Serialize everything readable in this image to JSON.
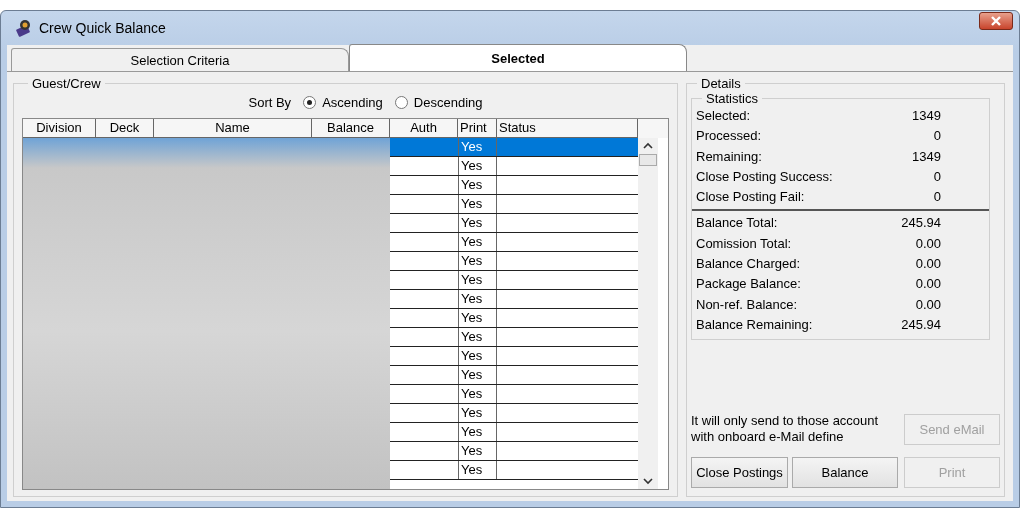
{
  "window": {
    "title": "Crew Quick Balance"
  },
  "tabs": [
    {
      "label": "Selection Criteria",
      "selected": false
    },
    {
      "label": "Selected",
      "selected": true
    }
  ],
  "guest_crew": {
    "title": "Guest/Crew",
    "sort_by": {
      "label": "Sort By",
      "options": [
        {
          "label": "Ascending",
          "selected": true
        },
        {
          "label": "Descending",
          "selected": false
        }
      ]
    },
    "table": {
      "columns": [
        "Division",
        "Deck",
        "Name",
        "Balance",
        "Auth",
        "Print",
        "Status"
      ],
      "rows": [
        {
          "selected": true,
          "print": "Yes"
        },
        {
          "selected": false,
          "print": "Yes"
        },
        {
          "selected": false,
          "print": "Yes"
        },
        {
          "selected": false,
          "print": "Yes"
        },
        {
          "selected": false,
          "print": "Yes"
        },
        {
          "selected": false,
          "print": "Yes"
        },
        {
          "selected": false,
          "print": "Yes"
        },
        {
          "selected": false,
          "print": "Yes"
        },
        {
          "selected": false,
          "print": "Yes"
        },
        {
          "selected": false,
          "print": "Yes"
        },
        {
          "selected": false,
          "print": "Yes"
        },
        {
          "selected": false,
          "print": "Yes"
        },
        {
          "selected": false,
          "print": "Yes"
        },
        {
          "selected": false,
          "print": "Yes"
        },
        {
          "selected": false,
          "print": "Yes"
        },
        {
          "selected": false,
          "print": "Yes"
        },
        {
          "selected": false,
          "print": "Yes"
        },
        {
          "selected": false,
          "print": "Yes"
        }
      ]
    }
  },
  "details": {
    "title": "Details",
    "statistics": {
      "title": "Statistics",
      "counts": [
        {
          "label": "Selected:",
          "value": "1349"
        },
        {
          "label": "Processed:",
          "value": "0"
        },
        {
          "label": "Remaining:",
          "value": "1349"
        },
        {
          "label": "Close Posting Success:",
          "value": "0"
        },
        {
          "label": "Close Posting Fail:",
          "value": "0"
        }
      ],
      "totals": [
        {
          "label": "Balance Total:",
          "value": "245.94"
        },
        {
          "label": "Comission Total:",
          "value": "0.00"
        },
        {
          "label": "Balance Charged:",
          "value": "0.00"
        },
        {
          "label": "Package Balance:",
          "value": "0.00"
        },
        {
          "label": "Non-ref. Balance:",
          "value": "0.00"
        },
        {
          "label": "Balance Remaining:",
          "value": "245.94"
        }
      ]
    },
    "note": "It will only send to those account with onboard e-Mail define",
    "email_button": {
      "label": "Send eMail",
      "disabled": true
    },
    "buttons": [
      {
        "label": "Close Postings",
        "disabled": false
      },
      {
        "label": "Balance",
        "disabled": false
      },
      {
        "label": "Print",
        "disabled": true
      }
    ]
  }
}
